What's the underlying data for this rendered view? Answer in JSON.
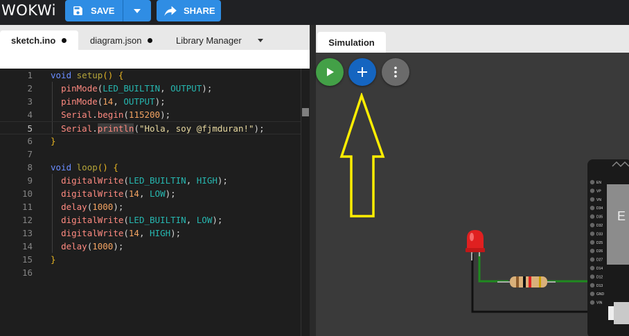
{
  "app": {
    "logo_text": "WOKWi"
  },
  "toolbar": {
    "save_label": "SAVE",
    "share_label": "SHARE"
  },
  "editor": {
    "tabs": [
      {
        "label": "sketch.ino",
        "modified": true,
        "active": true
      },
      {
        "label": "diagram.json",
        "modified": true,
        "active": false
      },
      {
        "label": "Library Manager",
        "active": false
      }
    ],
    "current_line": 5,
    "lines": [
      {
        "n": "1",
        "tokens": [
          [
            "kw",
            "void "
          ],
          [
            "fn",
            "setup"
          ],
          [
            "pun",
            "() {"
          ]
        ]
      },
      {
        "n": "2",
        "tokens": [
          [
            "txt",
            "  "
          ],
          [
            "call",
            "pinMode"
          ],
          [
            "txt",
            "("
          ],
          [
            "cst",
            "LED_BUILTIN"
          ],
          [
            "txt",
            ", "
          ],
          [
            "cst",
            "OUTPUT"
          ],
          [
            "txt",
            ");"
          ]
        ]
      },
      {
        "n": "3",
        "tokens": [
          [
            "txt",
            "  "
          ],
          [
            "call",
            "pinMode"
          ],
          [
            "txt",
            "("
          ],
          [
            "num",
            "14"
          ],
          [
            "txt",
            ", "
          ],
          [
            "cst",
            "OUTPUT"
          ],
          [
            "txt",
            ");"
          ]
        ]
      },
      {
        "n": "4",
        "tokens": [
          [
            "txt",
            "  "
          ],
          [
            "call",
            "Serial"
          ],
          [
            "txt",
            "."
          ],
          [
            "call",
            "begin"
          ],
          [
            "txt",
            "("
          ],
          [
            "num",
            "115200"
          ],
          [
            "txt",
            ");"
          ]
        ]
      },
      {
        "n": "5",
        "tokens": [
          [
            "txt",
            "  "
          ],
          [
            "call",
            "Serial"
          ],
          [
            "txt",
            "."
          ],
          [
            "callhl",
            "println"
          ],
          [
            "txt",
            "("
          ],
          [
            "str",
            "\"Hola, soy @fjmduran!\""
          ],
          [
            "txt",
            ");"
          ]
        ]
      },
      {
        "n": "6",
        "tokens": [
          [
            "pun",
            "}"
          ]
        ]
      },
      {
        "n": "7",
        "tokens": []
      },
      {
        "n": "8",
        "tokens": [
          [
            "kw",
            "void "
          ],
          [
            "fn",
            "loop"
          ],
          [
            "pun",
            "() {"
          ]
        ]
      },
      {
        "n": "9",
        "tokens": [
          [
            "txt",
            "  "
          ],
          [
            "call",
            "digitalWrite"
          ],
          [
            "txt",
            "("
          ],
          [
            "cst",
            "LED_BUILTIN"
          ],
          [
            "txt",
            ", "
          ],
          [
            "cst",
            "HIGH"
          ],
          [
            "txt",
            ");"
          ]
        ]
      },
      {
        "n": "10",
        "tokens": [
          [
            "txt",
            "  "
          ],
          [
            "call",
            "digitalWrite"
          ],
          [
            "txt",
            "("
          ],
          [
            "num",
            "14"
          ],
          [
            "txt",
            ", "
          ],
          [
            "cst",
            "LOW"
          ],
          [
            "txt",
            ");"
          ]
        ]
      },
      {
        "n": "11",
        "tokens": [
          [
            "txt",
            "  "
          ],
          [
            "call",
            "delay"
          ],
          [
            "txt",
            "("
          ],
          [
            "num",
            "1000"
          ],
          [
            "txt",
            ");"
          ]
        ]
      },
      {
        "n": "12",
        "tokens": [
          [
            "txt",
            "  "
          ],
          [
            "call",
            "digitalWrite"
          ],
          [
            "txt",
            "("
          ],
          [
            "cst",
            "LED_BUILTIN"
          ],
          [
            "txt",
            ", "
          ],
          [
            "cst",
            "LOW"
          ],
          [
            "txt",
            ");"
          ]
        ]
      },
      {
        "n": "13",
        "tokens": [
          [
            "txt",
            "  "
          ],
          [
            "call",
            "digitalWrite"
          ],
          [
            "txt",
            "("
          ],
          [
            "num",
            "14"
          ],
          [
            "txt",
            ", "
          ],
          [
            "cst",
            "HIGH"
          ],
          [
            "txt",
            ");"
          ]
        ]
      },
      {
        "n": "14",
        "tokens": [
          [
            "txt",
            "  "
          ],
          [
            "call",
            "delay"
          ],
          [
            "txt",
            "("
          ],
          [
            "num",
            "1000"
          ],
          [
            "txt",
            ");"
          ]
        ]
      },
      {
        "n": "15",
        "tokens": [
          [
            "pun",
            "}"
          ]
        ]
      },
      {
        "n": "16",
        "tokens": []
      }
    ]
  },
  "simulation": {
    "tab_label": "Simulation",
    "buttons": [
      {
        "name": "start-simulation-button",
        "icon": "play-icon",
        "color": "#43a047"
      },
      {
        "name": "add-part-button",
        "icon": "plus-icon",
        "color": "#1565c0"
      },
      {
        "name": "more-options-button",
        "icon": "more-vert-icon",
        "color": "#6b6b6b"
      }
    ],
    "annotation": {
      "type": "arrow",
      "points_to": "add-part-button",
      "color": "#ffee00"
    },
    "board": {
      "chip_text": "E",
      "left_pins": [
        "EN",
        "VP",
        "VN",
        "D34",
        "D35",
        "D32",
        "D33",
        "D25",
        "D26",
        "D27",
        "D14",
        "D12",
        "D13",
        "GND",
        "VIN"
      ]
    },
    "parts": [
      "red-led",
      "resistor",
      "esp32-board"
    ]
  }
}
